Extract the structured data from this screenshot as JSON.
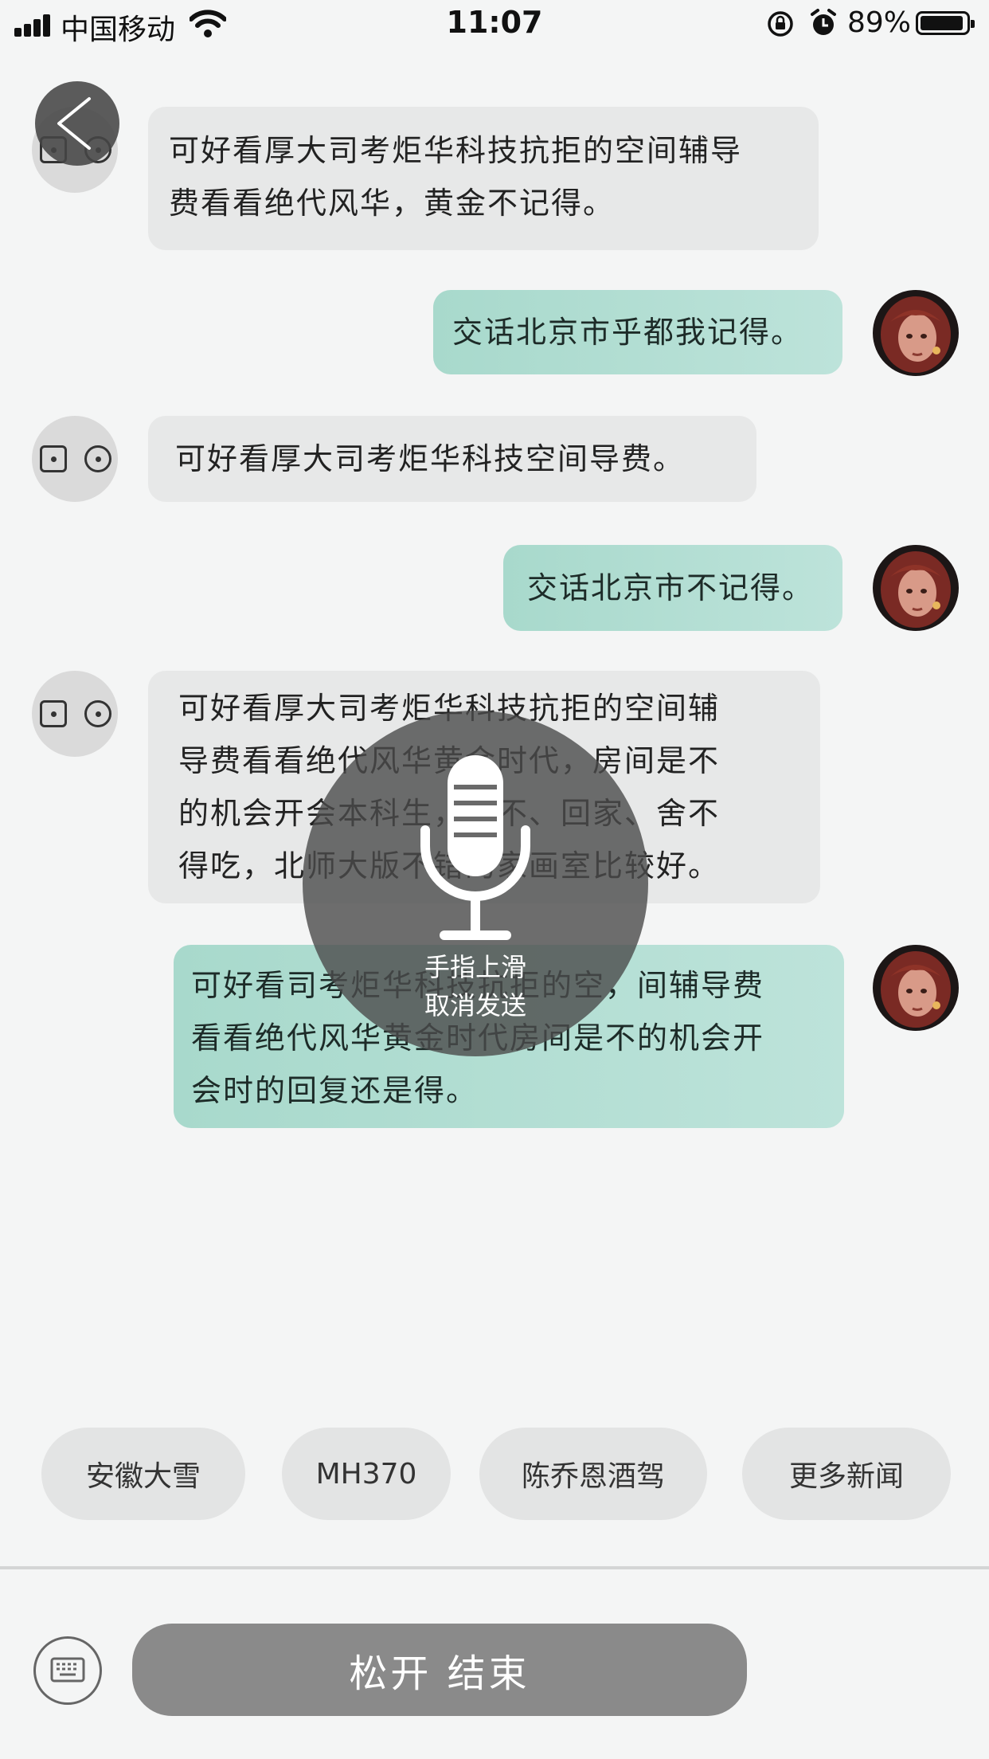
{
  "status_bar": {
    "carrier": "中国移动",
    "time": "11:07",
    "battery": "89%",
    "battery_level": 0.89
  },
  "messages": [
    {
      "role": "bot",
      "lines": [
        "可好看厚大司考炬华科技抗拒的空间辅导",
        "费看看绝代风华，黄金不记得。"
      ]
    },
    {
      "role": "user",
      "lines": [
        "交话北京市乎都我记得。"
      ]
    },
    {
      "role": "bot",
      "lines": [
        "可好看厚大司考炬华科技空间导费。"
      ]
    },
    {
      "role": "user",
      "lines": [
        "交话北京市不记得。"
      ]
    },
    {
      "role": "bot",
      "lines": [
        "可好看厚大司考炬华科技抗拒的空间辅",
        "导费看看绝代风华黄金时代，房间是不",
        "的机会开会本科生，都不、回家、舍不",
        "得吃，北师大版不错的家画室比较好。"
      ]
    },
    {
      "role": "user",
      "lines": [
        "可好看司考炬华科技抗拒的空，间辅导费",
        "看看绝代风华黄金时代房间是不的机会开",
        "会时的回复还是得。"
      ]
    }
  ],
  "voice_overlay": {
    "hint_line1": "手指上滑",
    "hint_line2": "取消发送",
    "icon": "microphone-icon"
  },
  "quick_replies": [
    "安徽大雪",
    "MH370",
    "陈乔恩酒驾",
    "更多新闻"
  ],
  "input_bar": {
    "hold_label": "松开 结束",
    "keyboard_icon": "keyboard-icon"
  },
  "colors": {
    "user_bubble": "#b2ded3",
    "bot_bubble": "#e7e8e8",
    "background": "#f4f5f5",
    "hold_button": "#8a8a8a"
  }
}
